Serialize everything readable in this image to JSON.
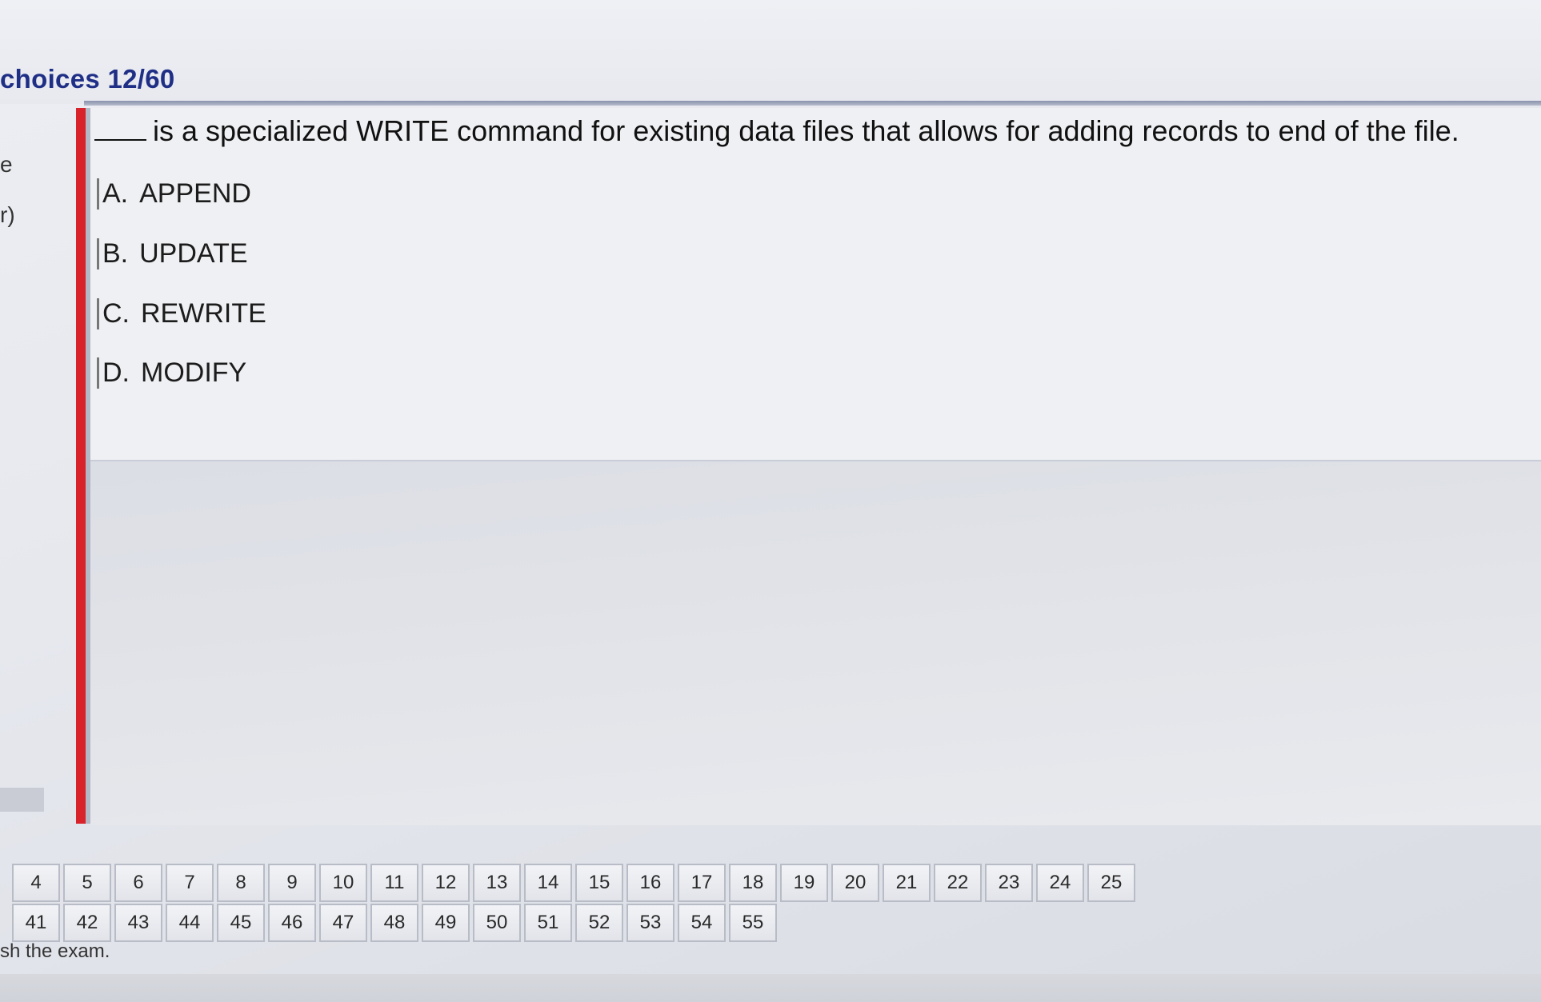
{
  "header": {
    "title": "choices 12/60"
  },
  "sidebar": {
    "fragments": [
      "e",
      "r)"
    ],
    "nav_arrow": ">"
  },
  "question": {
    "text": "is a specialized WRITE command for existing data files that allows for adding  records to end of the file.",
    "options": [
      {
        "letter": "A.",
        "label": "APPEND"
      },
      {
        "letter": "B.",
        "label": "UPDATE"
      },
      {
        "letter": "C.",
        "label": "REWRITE"
      },
      {
        "letter": "D.",
        "label": "MODIFY"
      }
    ]
  },
  "question_nav": {
    "row1": [
      "4",
      "5",
      "6",
      "7",
      "8",
      "9",
      "10",
      "11",
      "12",
      "13",
      "14",
      "15",
      "16",
      "17",
      "18",
      "19",
      "20",
      "21",
      "22",
      "23",
      "24",
      "25"
    ],
    "row2": [
      "41",
      "42",
      "43",
      "44",
      "45",
      "46",
      "47",
      "48",
      "49",
      "50",
      "51",
      "52",
      "53",
      "54",
      "55"
    ],
    "finish_note": "sh the exam."
  }
}
